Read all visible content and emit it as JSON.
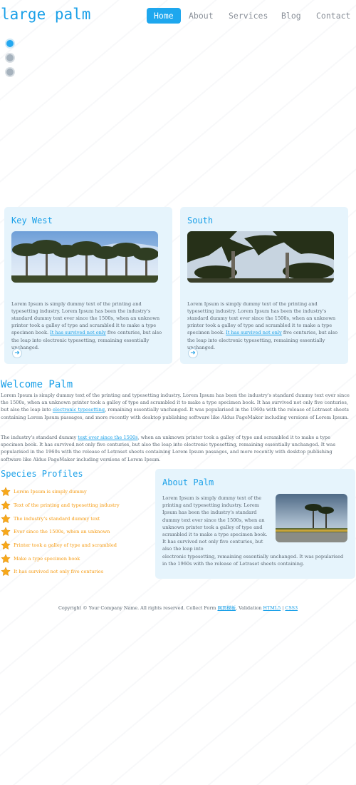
{
  "site": {
    "title": "large palm"
  },
  "nav": {
    "items": [
      {
        "label": "Home",
        "active": true
      },
      {
        "label": "About",
        "active": false
      },
      {
        "label": "Services",
        "active": false
      },
      {
        "label": "Blog",
        "active": false
      },
      {
        "label": "Contact",
        "active": false
      }
    ]
  },
  "slider": {
    "dot_count": 3,
    "active_index": 0
  },
  "features": [
    {
      "title": "Key West",
      "text_before": "Lorem Ipsum is simply dummy text of the printing and typesetting industry. Lorem Ipsum has been the industry's standard dummy text ever since the 1500s, when an unknown printer took a galley of type and scrambled it to make a type specimen book. ",
      "link": "It has survived not only",
      "text_after": " five centuries, but also the leap into electronic typesetting, remaining essentially unchanged.",
      "more_icon": "arrow-right-icon"
    },
    {
      "title": "South",
      "text_before": "Lorem Ipsum is simply dummy text of the printing and typesetting industry. Lorem Ipsum has been the industry's standard dummy text ever since the 1500s, when an unknown printer took a galley of type and scrambled it to make a type specimen book. ",
      "link": "It has survived not only",
      "text_after": " five centuries, but also the leap into electronic typesetting, remaining essentially unchanged.",
      "more_icon": "arrow-right-icon"
    }
  ],
  "welcome": {
    "title": "Welcome Palm",
    "p1_before": "Lorem Ipsum is simply dummy text of the printing and typesetting industry. Lorem Ipsum has been the industry's standard dummy text ever since the 1500s, when an unknown printer took a galley of type and scrambled it to make a type specimen book. It has survived not only five centuries, but also the leap into ",
    "p1_link": "electronic typesetting",
    "p1_after": ", remaining essentially unchanged. It was popularised in the 1960s with the release of Letraset sheets containing Lorem Ipsum passages, and more recently with desktop publishing software like Aldus PageMaker including versions of Lorem Ipsum.",
    "p2_before": "The industry's standard dummy ",
    "p2_link": "text ever since the 1500s",
    "p2_after": ", when an unknown printer took a galley of type and scrambled it to make a type specimen book. It has survived not only five centuries, but also the leap into electronic typesetting, remaining essentially unchanged. It was popularised in the 1960s with the release of Letraset sheets containing Lorem Ipsum passages, and more recently with desktop publishing software like Aldus PageMaker including versions of Lorem Ipsum."
  },
  "species": {
    "title": "Species Profiles",
    "items": [
      "Lorem Ipsum is simply dummy",
      "Text of the printing and typesetting industry",
      "The industry's standard dummy text",
      "Ever since the 1500s, when an unknown",
      "Printer took a galley of type and scrambled",
      "Make a type specimen book",
      "It has survived not only five centuries"
    ],
    "bullet_icon": "star-icon",
    "item_color": "#f59a10"
  },
  "about": {
    "title": "About Palm",
    "text_wrapped": "Lorem Ipsum is simply dummy text of the printing and typesetting industry. Lorem Ipsum has been the industry's standard dummy text ever since the 1500s, when an unknown printer took a galley of type and scrambled it to make a type specimen book. It has survived not only five centuries, but also the leap into",
    "text_full": "electronic typesetting, remaining essentially unchanged. It was popularised in the 1960s with the release of Letraset sheets containing."
  },
  "footer": {
    "text": "Copyright © Your Company Name. All rights reserved. Collect Form ",
    "link1": "网页模板",
    "mid": ", Validation ",
    "link2": "HTML5",
    "sep": " | ",
    "link3": "CSS3"
  },
  "colors": {
    "accent": "#1aa0e8",
    "box_bg": "#e6f4fc",
    "nav_active": "#1ea7ee",
    "star": "#f7a81b"
  }
}
